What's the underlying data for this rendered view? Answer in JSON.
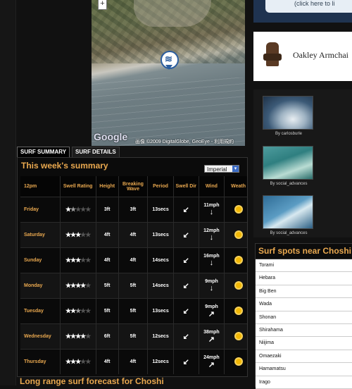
{
  "map": {
    "zoom_label": "+",
    "logo": "Google",
    "copyright": "画像 ©2009 DigitalGlobe, GeoEye - 利用規約"
  },
  "tabs": [
    {
      "label": "SURF SUMMARY",
      "active": true
    },
    {
      "label": "SURF DETAILS",
      "active": false
    }
  ],
  "summary": {
    "title": "This week's summary",
    "units_selected": "Imperial",
    "headers": [
      "12pm",
      "Swell Rating",
      "Height",
      "Breaking Wave",
      "Period",
      "Swell Dir",
      "Wind",
      "Weath"
    ],
    "rows": [
      {
        "day": "Friday",
        "rating": 1.5,
        "height": "3ft",
        "breaking": "3ft",
        "period": "13secs",
        "swell_dir": "↙",
        "wind_speed": "11mph",
        "wind_dir": "↓",
        "weather": "sun-icon"
      },
      {
        "day": "Saturday",
        "rating": 3,
        "height": "4ft",
        "breaking": "4ft",
        "period": "13secs",
        "swell_dir": "↙",
        "wind_speed": "12mph",
        "wind_dir": "↓",
        "weather": "sun-icon"
      },
      {
        "day": "Sunday",
        "rating": 3,
        "height": "4ft",
        "breaking": "4ft",
        "period": "14secs",
        "swell_dir": "↙",
        "wind_speed": "16mph",
        "wind_dir": "↓",
        "weather": "sun-icon"
      },
      {
        "day": "Monday",
        "rating": 4,
        "height": "5ft",
        "breaking": "5ft",
        "period": "14secs",
        "swell_dir": "↙",
        "wind_speed": "9mph",
        "wind_dir": "↓",
        "weather": "sun-icon"
      },
      {
        "day": "Tuesday",
        "rating": 2.5,
        "height": "5ft",
        "breaking": "5ft",
        "period": "13secs",
        "swell_dir": "↙",
        "wind_speed": "9mph",
        "wind_dir": "↗",
        "weather": "sun-icon"
      },
      {
        "day": "Wednesday",
        "rating": 4,
        "height": "6ft",
        "breaking": "5ft",
        "period": "12secs",
        "swell_dir": "↙",
        "wind_speed": "38mph",
        "wind_dir": "↗",
        "weather": "sun-icon"
      },
      {
        "day": "Thursday",
        "rating": 3,
        "height": "4ft",
        "breaking": "4ft",
        "period": "12secs",
        "swell_dir": "↙",
        "wind_speed": "24mph",
        "wind_dir": "↗",
        "weather": "sun-icon"
      }
    ]
  },
  "long_range_title": "Long range surf forecast for Choshi",
  "ads": {
    "top_text": "(click here to li",
    "chair_text": "Oakley Armchai"
  },
  "gallery": [
    {
      "caption": "By carlosburle"
    },
    {
      "caption": "By social_advances"
    },
    {
      "caption": "By social_advances"
    }
  ],
  "spots": {
    "title": "Surf spots near Choshi",
    "items": [
      "Torami",
      "Hebara",
      "Big Ben",
      "Wada",
      "Shonan",
      "Shirahama",
      "Niijima",
      "Omaezaki",
      "Hamamatsu",
      "Irago"
    ]
  },
  "colors": {
    "accent": "#e9a84f",
    "background": "#111111",
    "sun": "#f2b705"
  }
}
